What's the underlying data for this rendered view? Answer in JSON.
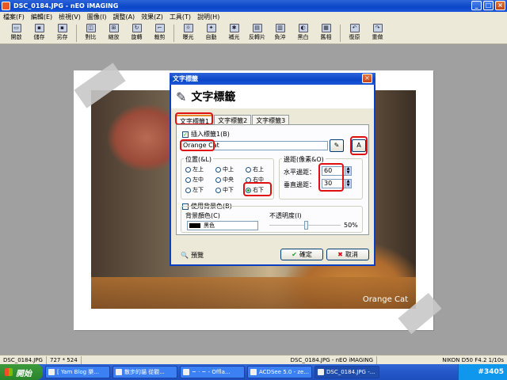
{
  "window": {
    "title": "DSC_0184.JPG - nEO iMAGING"
  },
  "menu": [
    "檔案(F)",
    "編輯(E)",
    "檢視(V)",
    "圖像(I)",
    "調整(A)",
    "效果(Z)",
    "工具(T)",
    "說明(H)"
  ],
  "toolbar": [
    {
      "label": "開啟",
      "icon": "open-icon"
    },
    {
      "label": "儲存",
      "icon": "save-icon"
    },
    {
      "label": "另存",
      "icon": "save-as-icon"
    },
    {
      "label": "對比",
      "icon": "compare-icon"
    },
    {
      "label": "縮放",
      "icon": "zoom-icon"
    },
    {
      "label": "旋轉",
      "icon": "rotate-icon"
    },
    {
      "label": "裁剪",
      "icon": "crop-icon"
    },
    {
      "label": "曝光",
      "icon": "exposure-icon"
    },
    {
      "label": "自動",
      "icon": "auto-icon"
    },
    {
      "label": "補光",
      "icon": "fill-light-icon"
    },
    {
      "label": "反轉片",
      "icon": "slide-film-icon"
    },
    {
      "label": "負沖",
      "icon": "cross-process-icon"
    },
    {
      "label": "黑白",
      "icon": "black-white-icon"
    },
    {
      "label": "舊相",
      "icon": "old-photo-icon"
    },
    {
      "label": "復原",
      "icon": "undo-icon"
    },
    {
      "label": "重做",
      "icon": "redo-icon"
    }
  ],
  "dialog": {
    "title": "文字標籤",
    "header": "文字標籤",
    "tabs": [
      "文字標籤1",
      "文字標籤2",
      "文字標籤3"
    ],
    "insert_label": "插入標籤1(B)",
    "text_value": "Orange Cat",
    "position_label": "位置(&L)",
    "positions": [
      {
        "label": "左上",
        "selected": false
      },
      {
        "label": "中上",
        "selected": false
      },
      {
        "label": "右上",
        "selected": false
      },
      {
        "label": "左中",
        "selected": false
      },
      {
        "label": "中央",
        "selected": false
      },
      {
        "label": "右中",
        "selected": false
      },
      {
        "label": "左下",
        "selected": false
      },
      {
        "label": "中下",
        "selected": false
      },
      {
        "label": "右下",
        "selected": true
      }
    ],
    "margin_label": "邊距(像素&O)",
    "h_margin_label": "水平邊距：",
    "h_margin_value": "60",
    "v_margin_label": "垂直邊距：",
    "v_margin_value": "30",
    "use_bg_label": "使用背景色(B)",
    "bg_color_label": "背景顏色(C)",
    "bg_color_value": "黑色",
    "opacity_label": "不透明度(I)",
    "opacity_value": "50%",
    "opacity_level": 0.5,
    "preview_label": "預覽",
    "ok_label": "確定",
    "cancel_label": "取消"
  },
  "photo": {
    "watermark": "Orange Cat"
  },
  "status": {
    "filename": "DSC_0184.JPG",
    "size": "727 * 524",
    "title": "DSC_0184.JPG - nEO iMAGING",
    "camera": "NIKON D50 F4.2 1/10s"
  },
  "taskbar": {
    "start": "開始",
    "items": [
      "[ Yam Blog 樂...",
      "散步的貓 從觀...",
      "~ · ~ - Offla...",
      "ACDSee 5.0 - ze...",
      "DSC_0184.JPG -..."
    ],
    "tray_text": "#3405"
  }
}
